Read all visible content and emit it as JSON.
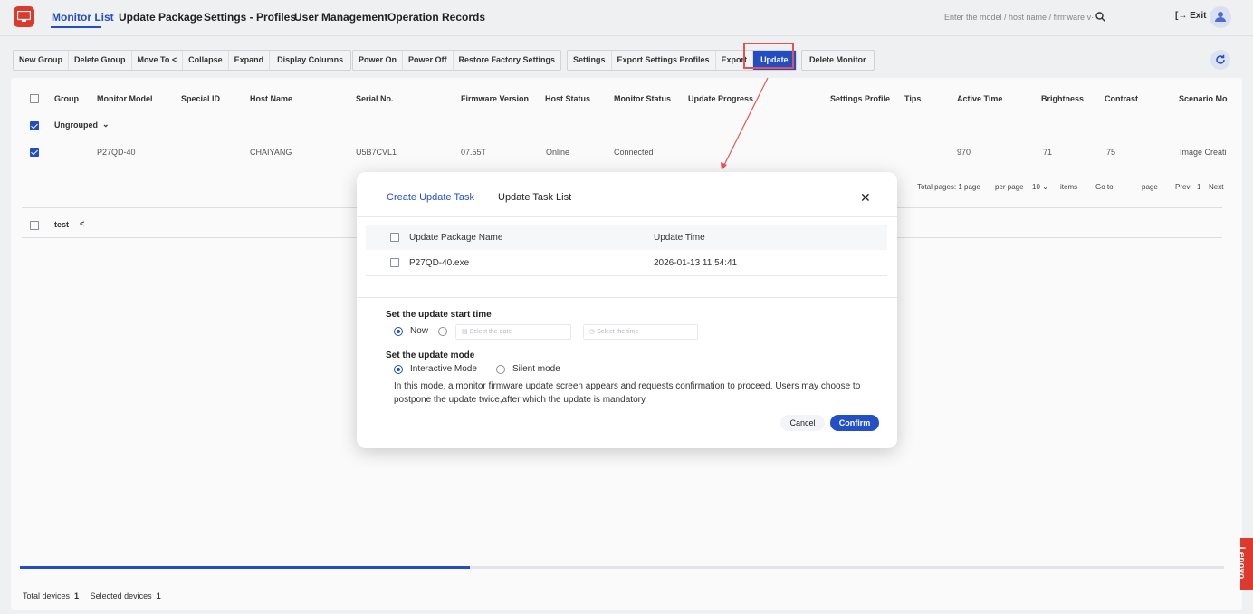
{
  "nav": {
    "items": [
      "Monitor List",
      "Update Package",
      "Settings - Profiles",
      "User Management",
      "Operation Records"
    ],
    "search_placeholder": "Enter the model / host name / firmware v···",
    "exit_label": "Exit"
  },
  "toolbar": {
    "group1": [
      "New Group",
      "Delete Group",
      "Move To <",
      "Collapse",
      "Expand",
      "Display Columns"
    ],
    "group2": [
      "Power On",
      "Power Off",
      "Restore Factory Settings"
    ],
    "group3": [
      "Settings",
      "Export Settings Profiles",
      "Export",
      "Update"
    ],
    "group4": [
      "Delete Monitor"
    ]
  },
  "table": {
    "columns": [
      "Group",
      "Monitor Model",
      "Special ID",
      "Host Name",
      "Serial No.",
      "Firmware Version",
      "Host Status",
      "Monitor Status",
      "Update Progress",
      "Settings Profile",
      "Tips",
      "Active Time",
      "Brightness",
      "Contrast",
      "Scenario Mo"
    ],
    "group_ungrouped": "Ungrouped",
    "group_test": "test",
    "row": {
      "model": "P27QD-40",
      "host": "CHAIYANG",
      "serial": "U5B7CVL1",
      "firmware": "07.55T",
      "host_status": "Online",
      "monitor_status": "Connected",
      "active_time": "970",
      "brightness": "71",
      "contrast": "75",
      "scenario": "Image Creati"
    },
    "pager": {
      "total_pages": "Total pages: 1 page",
      "per_page": "per page",
      "per_page_value": "10",
      "items": "items",
      "go_to": "Go to",
      "page": "page",
      "prev": "Prev",
      "current": "1",
      "next": "Next"
    }
  },
  "footer": {
    "total_label": "Total devices",
    "total_value": "1",
    "selected_label": "Selected devices",
    "selected_value": "1"
  },
  "side_tab": "Lenovo",
  "modal": {
    "tab_create": "Create Update Task",
    "tab_list": "Update Task List",
    "close_symbol": "✕",
    "col_name": "Update Package Name",
    "col_time": "Update Time",
    "pkg_name": "P27QD-40.exe",
    "pkg_time": "2026-01-13 11:54:41",
    "start_time_label": "Set the update start time",
    "now_label": "Now",
    "date_placeholder": "Select the date",
    "time_placeholder": "Select the time",
    "mode_label": "Set the update mode",
    "mode_interactive": "Interactive Mode",
    "mode_silent": "Silent mode",
    "mode_desc": "In this mode, a monitor firmware update screen appears and requests confirmation to proceed. Users may choose to postpone the update twice,after which the update is mandatory.",
    "cancel": "Cancel",
    "confirm": "Confirm"
  },
  "colors": {
    "accent": "#2350c5",
    "brand_red": "#e23b2e",
    "highlight_frame": "#e8545a"
  }
}
